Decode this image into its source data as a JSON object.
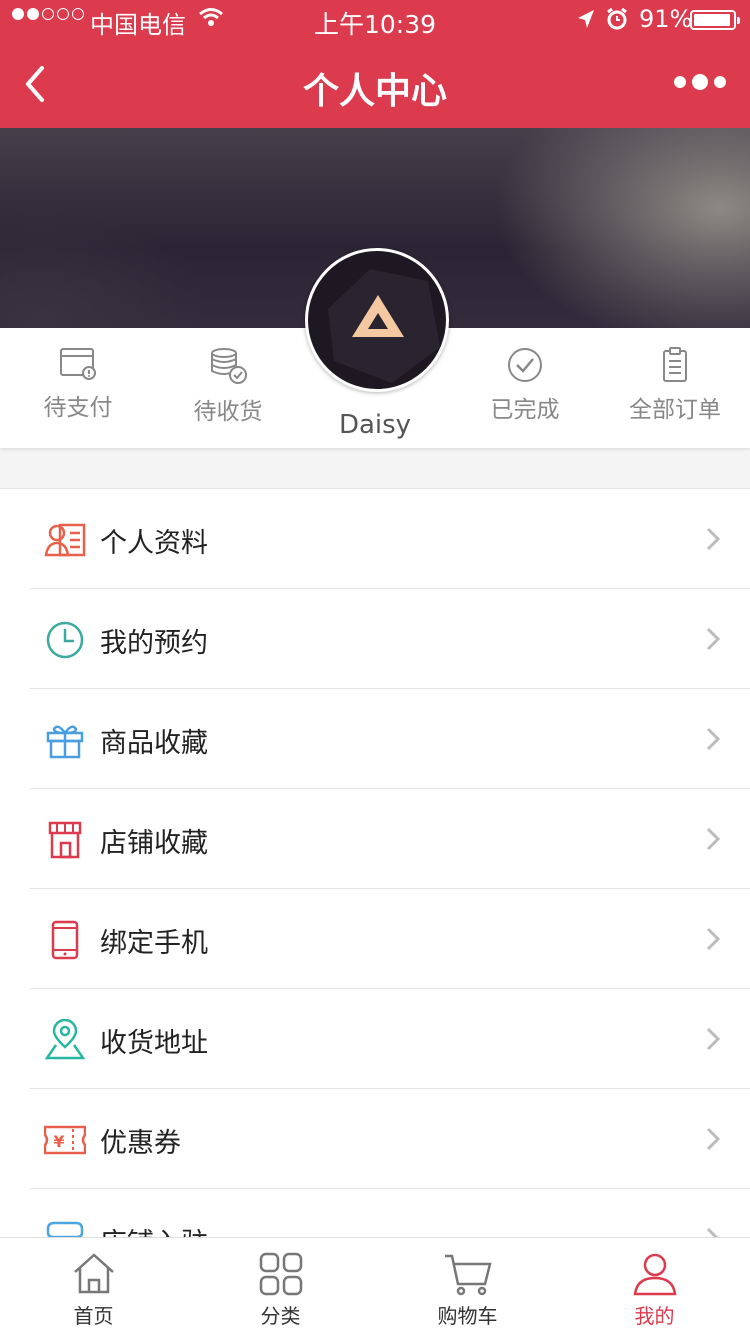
{
  "status_bar": {
    "carrier": "中国电信",
    "time": "上午10:39",
    "battery": "91%",
    "battery_level": 0.91
  },
  "nav": {
    "title": "个人中心"
  },
  "profile": {
    "username": "Daisy"
  },
  "orders": [
    {
      "label": "待支付",
      "icon": "pending-payment-icon"
    },
    {
      "label": "待收货",
      "icon": "pending-delivery-icon"
    },
    {
      "label": "已完成",
      "icon": "completed-check-icon"
    },
    {
      "label": "全部订单",
      "icon": "clipboard-icon"
    }
  ],
  "menu": [
    {
      "label": "个人资料",
      "icon": "profile-card-icon",
      "color": "#e8604a"
    },
    {
      "label": "我的预约",
      "icon": "clock-icon",
      "color": "#3aa99f"
    },
    {
      "label": "商品收藏",
      "icon": "gift-icon",
      "color": "#4a9ee0"
    },
    {
      "label": "店铺收藏",
      "icon": "store-icon",
      "color": "#dc3a4d"
    },
    {
      "label": "绑定手机",
      "icon": "phone-icon",
      "color": "#dc3a4d"
    },
    {
      "label": "收货地址",
      "icon": "location-icon",
      "color": "#27b7a0"
    },
    {
      "label": "优惠券",
      "icon": "coupon-icon",
      "color": "#e8604a"
    },
    {
      "label": "店铺入驻",
      "icon": "shop-join-icon",
      "color": "#4aa6e0"
    }
  ],
  "tabs": [
    {
      "label": "首页",
      "icon": "home-icon"
    },
    {
      "label": "分类",
      "icon": "category-grid-icon"
    },
    {
      "label": "购物车",
      "icon": "cart-icon"
    },
    {
      "label": "我的",
      "icon": "user-icon"
    }
  ],
  "colors": {
    "brand": "#dc3a4d",
    "muted_text": "#888888"
  }
}
